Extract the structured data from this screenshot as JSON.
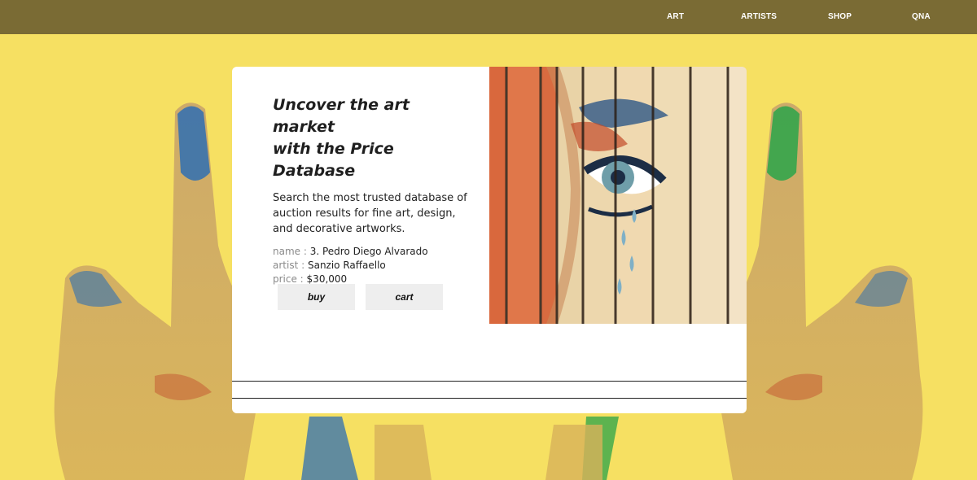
{
  "nav": {
    "items": [
      "ART",
      "ARTISTS",
      "SHOP",
      "QNA"
    ]
  },
  "hero": {
    "headline_line1": "Uncover the art market",
    "headline_line2": "with the Price Database",
    "description": "Search the most trusted database of auction results for fine art, design, and decorative artworks."
  },
  "artwork": {
    "name_label": "name : ",
    "name_value": "3. Pedro Diego Alvarado",
    "artist_label": "artist : ",
    "artist_value": "Sanzio Raffaello",
    "price_label": "price : ",
    "price_value": "$30,000"
  },
  "actions": {
    "buy_label": "buy",
    "cart_label": "cart"
  },
  "colors": {
    "nav_background": "#7a6b34",
    "page_background": "#f6e062",
    "card_background": "#ffffff",
    "button_background": "#eeeeee"
  },
  "icons": {
    "background": "paint-covered-hands-illustration",
    "artwork": "painted-eye-on-wooden-fence"
  }
}
